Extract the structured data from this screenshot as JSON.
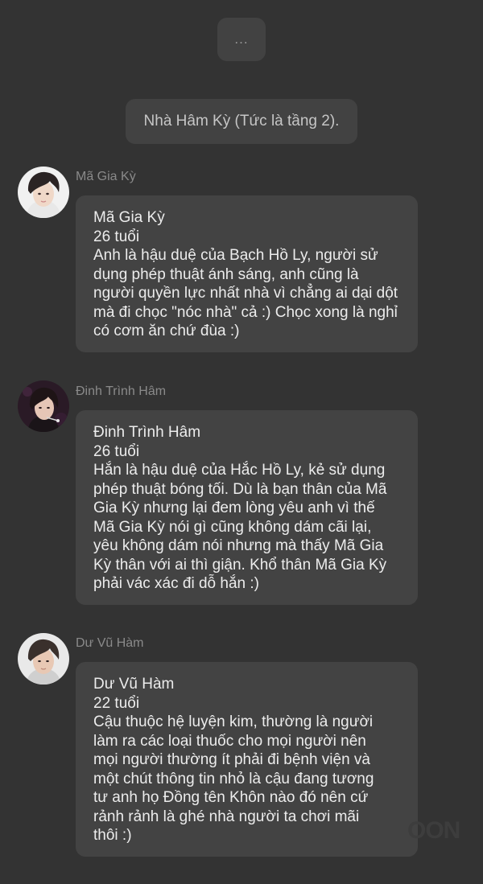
{
  "system_messages": [
    {
      "text": "..."
    },
    {
      "text": "Nhà Hâm Kỳ (Tức là tầng 2)."
    }
  ],
  "messages": [
    {
      "sender": "Mã Gia Kỳ",
      "lines": [
        "Mã Gia Kỳ",
        "26 tuổi",
        "Anh là hậu duệ của Bạch Hồ Ly, người sử",
        "dụng phép thuật ánh sáng, anh cũng là",
        "người quyền lực nhất nhà vì chẳng ai dại dột",
        "mà đi chọc \"nóc nhà\" cả :) Chọc xong là nghỉ",
        "có cơm ăn chứ đùa :)"
      ]
    },
    {
      "sender": "Đinh Trình Hâm",
      "lines": [
        "Đinh Trình Hâm",
        "26 tuổi",
        "Hắn là hậu duệ của Hắc Hồ Ly, kẻ sử dụng",
        "phép thuật bóng tối. Dù là bạn thân của Mã",
        "Gia Kỳ nhưng lại đem lòng yêu anh vì thế",
        "Mã Gia Kỳ nói gì cũng không dám cãi lại,",
        "yêu không dám nói nhưng mà thấy Mã Gia",
        "Kỳ thân với ai thì giận. Khổ thân Mã Gia Kỳ",
        "phải vác xác đi dỗ hắn :)"
      ]
    },
    {
      "sender": "Dư Vũ Hàm",
      "lines": [
        "Dư Vũ Hàm",
        "22 tuổi",
        "Cậu thuộc hệ luyện kim, thường là người",
        "làm ra các loại thuốc cho mọi người nên",
        "mọi người thường ít phải đi bệnh viện và",
        "một chút thông tin nhỏ là cậu đang tương",
        "tư anh họ Đồng tên Khôn nào đó nên cứ",
        "rảnh rảnh là ghé nhà người ta chơi mãi",
        "thôi :)"
      ]
    }
  ],
  "watermark": "OON",
  "colors": {
    "background": "#333333",
    "bubble": "#434343",
    "system_bubble": "#424242",
    "message_text": "#ececec",
    "sender_name": "#8a8a8a"
  },
  "icons": [
    "avatar-photo-ma-gia-ky",
    "avatar-photo-dinh-trinh-ham",
    "avatar-photo-du-vu-ham"
  ]
}
